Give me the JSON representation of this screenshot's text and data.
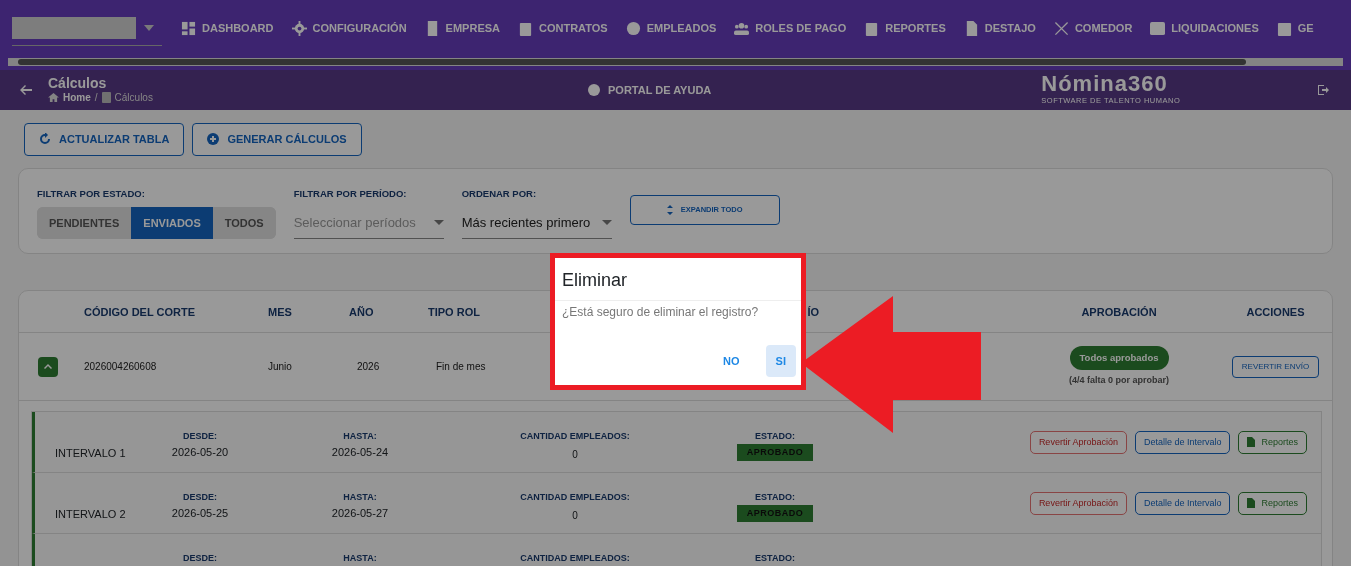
{
  "nav": {
    "items": [
      {
        "label": "DASHBOARD"
      },
      {
        "label": "CONFIGURACIÓN"
      },
      {
        "label": "EMPRESA"
      },
      {
        "label": "CONTRATOS"
      },
      {
        "label": "EMPLEADOS"
      },
      {
        "label": "ROLES DE PAGO"
      },
      {
        "label": "REPORTES"
      },
      {
        "label": "DESTAJO"
      },
      {
        "label": "COMEDOR"
      },
      {
        "label": "LIQUIDACIONES"
      },
      {
        "label": "GE"
      }
    ]
  },
  "page_header": {
    "title": "Cálculos",
    "breadcrumb": [
      "Home",
      "Cálculos"
    ],
    "breadcrumb_separator": "/",
    "help": "PORTAL DE AYUDA",
    "logo": "Nómina360",
    "tagline": "SOFTWARE DE TALENTO HUMANO"
  },
  "toolbar": [
    "ACTUALIZAR TABLA",
    "GENERAR CÁLCULOS"
  ],
  "filters": {
    "estado_label": "FILTRAR POR ESTADO:",
    "estado_options": [
      {
        "label": "PENDIENTES",
        "selected": false
      },
      {
        "label": "ENVIADOS",
        "selected": true
      },
      {
        "label": "TODOS",
        "selected": false
      }
    ],
    "periodo_label": "FILTRAR POR PERÍODO:",
    "periodo_placeholder": "Seleccionar períodos",
    "orden_label": "ORDENAR POR:",
    "orden_value": "Más recientes primero",
    "expand_button": "EXPANDIR TODO"
  },
  "table": {
    "columns": [
      "CÓDIGO DEL CORTE",
      "MES",
      "AÑO",
      "TIPO ROL",
      "ÍO",
      "APROBACIÓN",
      "ACCIONES"
    ],
    "rows": [
      {
        "expanded": true,
        "code": "2026004260608",
        "mes": "Junio",
        "anio": "2026",
        "tipo": "Fin de mes",
        "approval": "Todos aprobados",
        "approval_note": "(4/4 falta 0 por aprobar)",
        "action": "REVERTIR ENVÍO"
      }
    ]
  },
  "intervals": [
    {
      "name": "INTERVALO 1",
      "desde_label": "DESDE:",
      "desde": "2026-05-20",
      "hasta_label": "HASTA:",
      "hasta": "2026-05-24",
      "cantidad_label": "CANTIDAD EMPLEADOS:",
      "cantidad": "0",
      "estado_label": "ESTADO:",
      "estado": "APROBADO",
      "actions": [
        "Revertir Aprobación",
        "Detalle de Intervalo",
        "Reportes"
      ]
    },
    {
      "name": "INTERVALO 2",
      "desde_label": "DESDE:",
      "desde": "2026-05-25",
      "hasta_label": "HASTA:",
      "hasta": "2026-05-27",
      "cantidad_label": "CANTIDAD EMPLEADOS:",
      "cantidad": "0",
      "estado_label": "ESTADO:",
      "estado": "APROBADO",
      "actions": [
        "Revertir Aprobación",
        "Detalle de Intervalo",
        "Reportes"
      ]
    },
    {
      "desde_label": "DESDE:",
      "hasta_label": "HASTA:",
      "cantidad_label": "CANTIDAD EMPLEADOS:",
      "estado_label": "ESTADO:"
    }
  ],
  "dialog": {
    "title": "Eliminar",
    "message": "¿Está seguro de eliminar el registro?",
    "buttons": [
      {
        "label": "NO",
        "kind": "text"
      },
      {
        "label": "SI",
        "kind": "tonal"
      }
    ]
  }
}
